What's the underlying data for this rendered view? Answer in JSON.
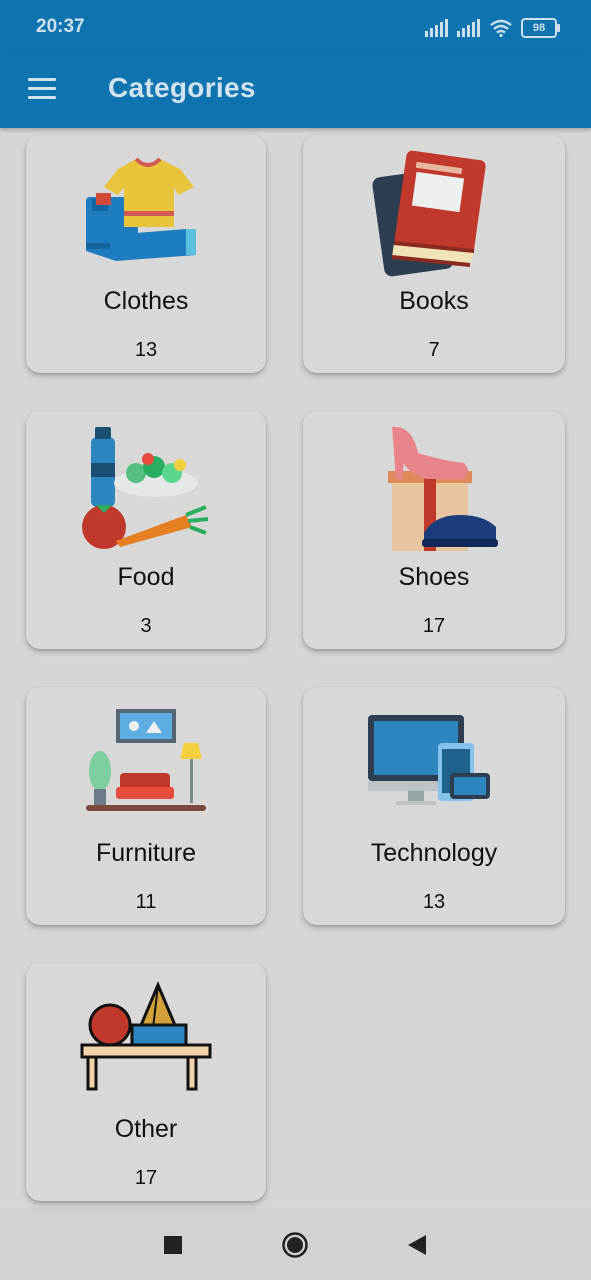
{
  "status_bar": {
    "time": "20:37",
    "battery": "98",
    "icons": [
      "signal-icon",
      "signal-icon",
      "wifi-icon",
      "battery-icon"
    ]
  },
  "app_bar": {
    "title": "Categories",
    "menu_icon": "menu-icon"
  },
  "categories": [
    {
      "name": "Clothes",
      "count": "13",
      "icon": "clothes-icon"
    },
    {
      "name": "Books",
      "count": "7",
      "icon": "books-icon"
    },
    {
      "name": "Food",
      "count": "3",
      "icon": "food-icon"
    },
    {
      "name": "Shoes",
      "count": "17",
      "icon": "shoes-icon"
    },
    {
      "name": "Furniture",
      "count": "11",
      "icon": "furniture-icon"
    },
    {
      "name": "Technology",
      "count": "13",
      "icon": "technology-icon"
    },
    {
      "name": "Other",
      "count": "17",
      "icon": "other-icon"
    }
  ],
  "nav_bar": {
    "icons": [
      "recents-icon",
      "home-icon",
      "back-icon"
    ]
  },
  "colors": {
    "primary": "#0e74b0",
    "background": "#d6d6d6",
    "card": "#d8d8d8"
  }
}
